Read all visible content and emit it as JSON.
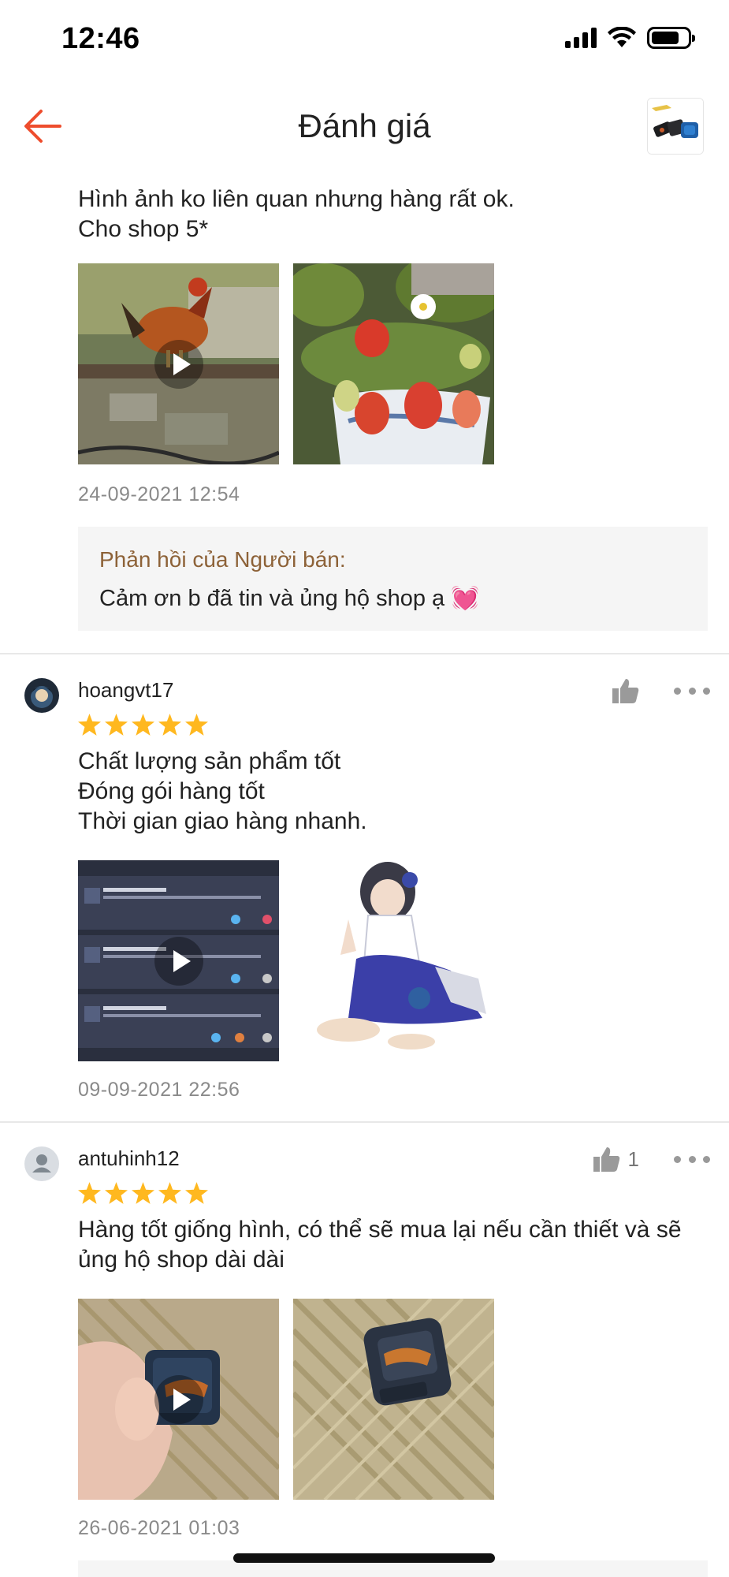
{
  "status_bar": {
    "time": "12:46"
  },
  "nav": {
    "title": "Đánh giá"
  },
  "reviews": [
    {
      "text": "Hình ảnh ko liên quan nhưng hàng rất ok.\nCho shop 5*",
      "date": "24-09-2021 12:54",
      "media": [
        "video-rooster",
        "photo-strawberries"
      ],
      "seller_reply": {
        "label": "Phản hồi của Người bán:",
        "text": "Cảm ơn b đã tin và ủng hộ shop ạ 💓"
      }
    },
    {
      "username": "hoangvt17",
      "rating": 5,
      "text": "Chất lượng sản phẩm tốt\nĐóng gói hàng tốt\nThời gian giao hàng nhanh.",
      "date": "09-09-2021 22:56",
      "media": [
        "video-game-screen",
        "photo-anime-character"
      ]
    },
    {
      "username": "antuhinh12",
      "rating": 5,
      "likes": "1",
      "text": "Hàng tốt giống hình, có thể sẽ mua lại nếu cần thiết và sẽ ủng hộ shop dài dài",
      "date": "26-06-2021 01:03",
      "media": [
        "video-product-in-hand",
        "photo-product-on-mat"
      ]
    }
  ],
  "colors": {
    "accent": "#ee4d2d",
    "star": "#ffb81f",
    "seller_label": "#8d6238",
    "date": "#8a8a8a",
    "reply_bg": "#f5f5f5"
  }
}
